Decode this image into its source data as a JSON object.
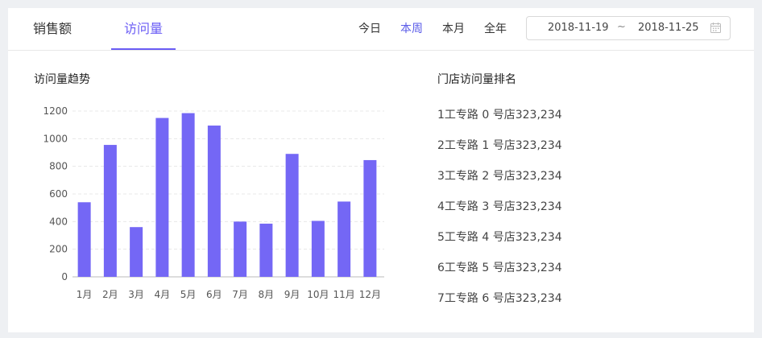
{
  "tabs": [
    {
      "label": "销售额",
      "active": false
    },
    {
      "label": "访问量",
      "active": true
    }
  ],
  "periods": [
    {
      "label": "今日",
      "active": false
    },
    {
      "label": "本周",
      "active": true
    },
    {
      "label": "本月",
      "active": false
    },
    {
      "label": "全年",
      "active": false
    }
  ],
  "date_range": {
    "start": "2018-11-19",
    "separator": "~",
    "end": "2018-11-25",
    "icon": "calendar-icon"
  },
  "trend_title": "访问量趋势",
  "ranking_title": "门店访问量排名",
  "colors": {
    "accent": "#6a5cf5",
    "bar": "#7467f5",
    "grid": "#e8e8e8"
  },
  "chart_data": {
    "type": "bar",
    "categories": [
      "1月",
      "2月",
      "3月",
      "4月",
      "5月",
      "6月",
      "7月",
      "8月",
      "9月",
      "10月",
      "11月",
      "12月"
    ],
    "values": [
      540,
      955,
      360,
      1150,
      1185,
      1095,
      400,
      385,
      890,
      405,
      545,
      845
    ],
    "ylim": [
      0,
      1200
    ],
    "yticks": [
      0,
      200,
      400,
      600,
      800,
      1000,
      1200
    ],
    "grid": true
  },
  "ranking": [
    {
      "rank": "1",
      "name": "工专路 0 号店",
      "value": "323,234"
    },
    {
      "rank": "2",
      "name": "工专路 1 号店",
      "value": "323,234"
    },
    {
      "rank": "3",
      "name": "工专路 2 号店",
      "value": "323,234"
    },
    {
      "rank": "4",
      "name": "工专路 3 号店",
      "value": "323,234"
    },
    {
      "rank": "5",
      "name": "工专路 4 号店",
      "value": "323,234"
    },
    {
      "rank": "6",
      "name": "工专路 5 号店",
      "value": "323,234"
    },
    {
      "rank": "7",
      "name": "工专路 6 号店",
      "value": "323,234"
    }
  ]
}
